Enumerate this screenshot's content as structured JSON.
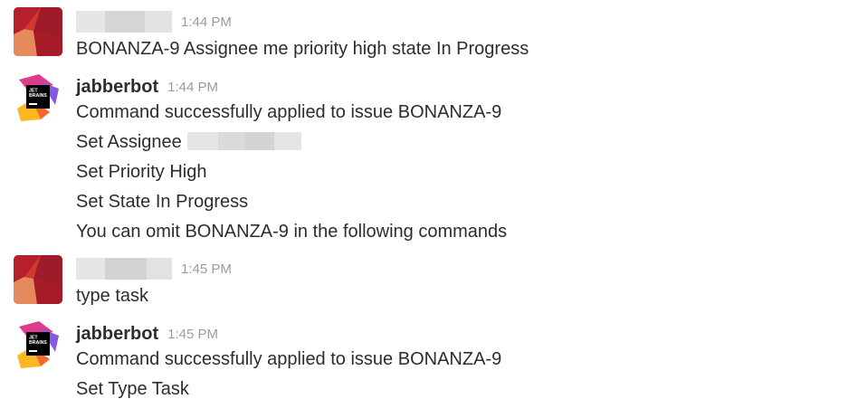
{
  "messages": [
    {
      "sender": "",
      "time": "1:44 PM",
      "lines": [
        "BONANZA-9 Assignee me priority high state In Progress"
      ]
    },
    {
      "sender": "jabberbot",
      "time": "1:44 PM",
      "lines": [
        "Command successfully applied to issue BONANZA-9",
        "Set Assignee",
        "Set Priority High",
        "Set State In Progress",
        "You can omit BONANZA-9 in the following commands"
      ]
    },
    {
      "sender": "",
      "time": "1:45 PM",
      "lines": [
        "type task"
      ]
    },
    {
      "sender": "jabberbot",
      "time": "1:45 PM",
      "lines": [
        "Command successfully applied to issue BONANZA-9",
        "Set Type Task"
      ]
    }
  ],
  "avatars": {
    "user": "user-avatar-red-geometric",
    "bot": "jetbrains-logo-icon",
    "bot_logo_text": [
      "JET",
      "BRAINS"
    ]
  },
  "colors": {
    "text": "#2c2d30",
    "timestamp": "#9a9b9e",
    "redacted": "#dcdcdc"
  }
}
